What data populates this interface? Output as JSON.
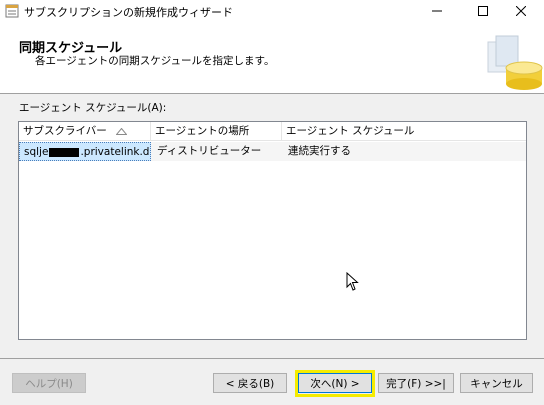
{
  "window": {
    "title": "サブスクリプションの新規作成ウィザード",
    "controls": {
      "minimize": "—",
      "maximize": "☐",
      "close": "✕"
    }
  },
  "header": {
    "title": "同期スケジュール",
    "subtitle": "各エージェントの同期スケジュールを指定します。",
    "art_icon": "database-icon"
  },
  "schedule": {
    "label": "エージェント スケジュール(A):",
    "columns": [
      "サブスクライバー",
      "エージェントの場所",
      "エージェント スケジュール"
    ],
    "sort_icon": "sort-ascending-icon",
    "rows": [
      {
        "subscriber_prefix": "sqlje",
        "subscriber_suffix": ".privatelink.da...",
        "location": "ディストリビューター",
        "schedule": "連続実行する"
      }
    ]
  },
  "buttons": {
    "help": "ヘルプ(H)",
    "back": "< 戻る(B)",
    "next": "次へ(N) >",
    "finish": "完了(F) >>|",
    "cancel": "キャンセル"
  },
  "colors": {
    "highlight": "#f5ec00",
    "selection": "#cce8ff",
    "focus_border": "#0078d7"
  }
}
